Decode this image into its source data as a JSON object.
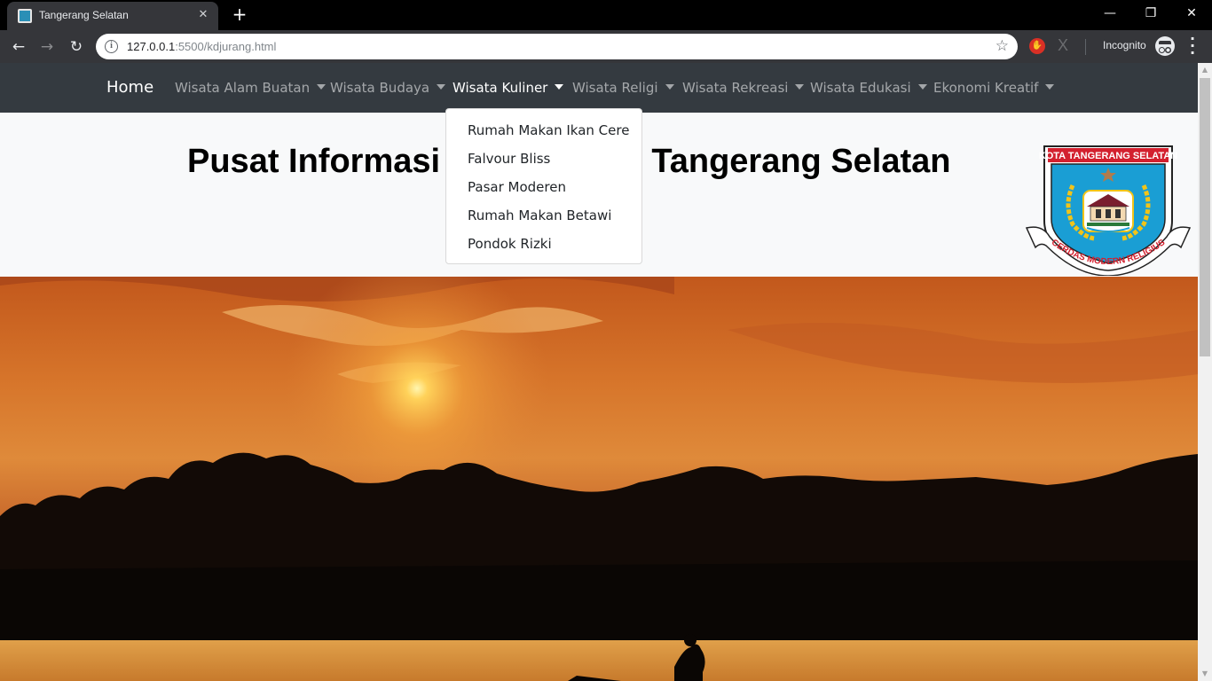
{
  "browser": {
    "tab_title": "Tangerang Selatan",
    "tab_close": "✕",
    "new_tab": "+",
    "url_host": "127.0.0.1",
    "url_path": ":5500/kdjurang.html",
    "incognito_label": "Incognito",
    "window_controls": {
      "minimize": "—",
      "restore": "❐",
      "close": "✕"
    },
    "nav": {
      "back": "←",
      "forward": "→",
      "reload": "↻"
    },
    "icons": [
      "favicon-icon",
      "info-icon",
      "star-icon",
      "adblock-icon",
      "extension-x-icon",
      "incognito-icon",
      "menu-icon"
    ]
  },
  "navbar": {
    "home": "Home",
    "items": [
      {
        "label": "Wisata Alam Buatan",
        "active": false
      },
      {
        "label": "Wisata Budaya",
        "active": false
      },
      {
        "label": "Wisata Kuliner",
        "active": true
      },
      {
        "label": "Wisata Religi",
        "active": false
      },
      {
        "label": "Wisata Rekreasi",
        "active": false
      },
      {
        "label": "Wisata Edukasi",
        "active": false
      },
      {
        "label": "Ekonomi Kreatif",
        "active": false
      }
    ]
  },
  "dropdown": {
    "items": [
      "Rumah Makan Ikan Cere",
      "Falvour Bliss",
      "Pasar Moderen",
      "Rumah Makan Betawi",
      "Pondok Rizki"
    ]
  },
  "header": {
    "title": "Pusat Informasi Wisata Kota Tangerang Selatan"
  },
  "logo": {
    "top_text": "KOTA TANGERANG SELATAN",
    "ribbon_text": "CERDAS MODERN RELIGIUS"
  },
  "colors": {
    "navbar_bg": "#343a40",
    "header_bg": "#f8f9fa",
    "logo_shield": "#1a9ed4",
    "logo_red": "#d3202e",
    "logo_gold": "#f2c418"
  }
}
